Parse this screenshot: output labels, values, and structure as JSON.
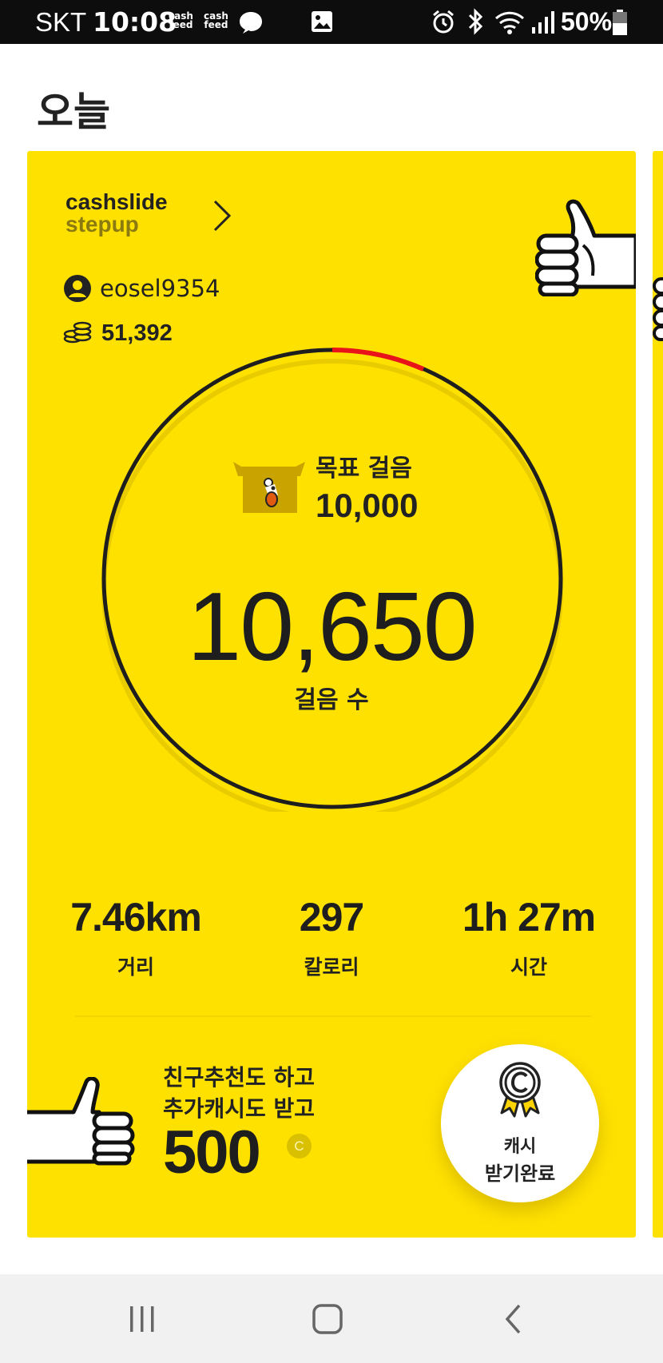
{
  "status_bar": {
    "carrier": "SKT",
    "time": "10:08",
    "feed_icons": [
      "cash feed",
      "cash feed"
    ],
    "battery": "50%",
    "icons": [
      "chat-bubble-icon",
      "image-icon",
      "alarm-icon",
      "bluetooth-icon",
      "wifi-icon",
      "signal-icon",
      "battery-icon"
    ]
  },
  "header": {
    "title": "오늘"
  },
  "card": {
    "brand_line1": "cashslide",
    "brand_line2": "stepup",
    "username": "eosel9354",
    "coins": "51,392",
    "goal_label": "목표 걸음",
    "goal_value": "10,000",
    "steps": "10,650",
    "steps_label": "걸음 수",
    "stats": [
      {
        "value": "7.46km",
        "label": "거리"
      },
      {
        "value": "297",
        "label": "칼로리"
      },
      {
        "value": "1h 27m",
        "label": "시간"
      }
    ],
    "promo_line1": "친구추천도 하고",
    "promo_line2": "추가캐시도 받고",
    "promo_amount": "500",
    "promo_coin_symbol": "C",
    "reward_line1": "캐시",
    "reward_line2": "받기완료"
  },
  "colors": {
    "card_bg": "#ffe100",
    "ring": "#1e1e1e",
    "ring_progress": "#e8141a"
  }
}
